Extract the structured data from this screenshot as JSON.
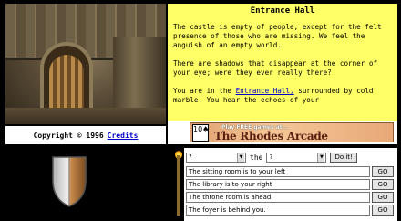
{
  "credits": {
    "copyright": "Copyright © 1996",
    "link": "Credits"
  },
  "room": {
    "title": "Entrance Hall",
    "para1": "The castle is empty of people, except for the felt presence of those who are missing. We feel the anguish of an empty world.",
    "para2": "There are shadows that disappear at the corner of your eye; were they ever really there?",
    "para3_prefix": "You are in the ",
    "para3_link": "Entrance Hall,",
    "para3_suffix": " surrounded by cold marble. You hear the echoes of your"
  },
  "ad": {
    "tagline": "Play FREE games at...",
    "name": "The Rhodes Arcade",
    "card": "10♠"
  },
  "command": {
    "verb_value": "?",
    "the_label": "the",
    "object_value": "?",
    "do_label": "Do it!",
    "suggestions": [
      "The sitting room is to your left",
      "The library is to your right",
      "The throne room is ahead",
      "The foyer is behind you."
    ],
    "go_label": "GO"
  },
  "colors": {
    "panel_bg": "#ffff66",
    "link": "#0000cc"
  },
  "icons": {
    "inventory_item": "shield-icon",
    "torch": "torch-icon"
  }
}
